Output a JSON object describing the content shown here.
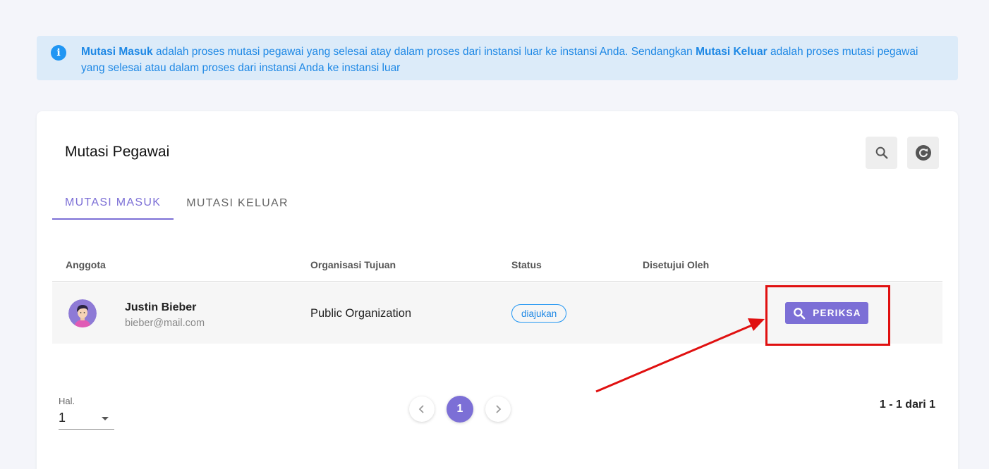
{
  "alert": {
    "part1_bold": "Mutasi Masuk",
    "part2": " adalah proses mutasi pegawai yang selesai atay dalam proses dari instansi luar ke instansi Anda. Sendangkan ",
    "part3_bold": "Mutasi Keluar",
    "part4": " adalah proses mutasi pegawai yang selesai atau dalam proses dari instansi Anda ke instansi luar"
  },
  "card": {
    "title": "Mutasi Pegawai",
    "tabs": [
      {
        "label": "MUTASI MASUK",
        "active": true
      },
      {
        "label": "MUTASI KELUAR",
        "active": false
      }
    ]
  },
  "table": {
    "columns": [
      "Anggota",
      "Organisasi Tujuan",
      "Status",
      "Disetujui Oleh"
    ],
    "rows": [
      {
        "name": "Justin Bieber",
        "email": "bieber@mail.com",
        "organization": "Public Organization",
        "status": "diajukan",
        "approved_by": "",
        "action": "PERIKSA"
      }
    ]
  },
  "pagination": {
    "label": "Hal.",
    "page_value": "1",
    "current_page": "1",
    "range_text": "1 - 1 dari 1"
  },
  "colors": {
    "accent": "#7c6fd6",
    "info": "#2196f3",
    "annotation": "#e01010"
  },
  "icons": [
    "info-icon",
    "search-icon",
    "refresh-icon",
    "chevron-left-icon",
    "chevron-right-icon",
    "dropdown-caret-icon"
  ]
}
